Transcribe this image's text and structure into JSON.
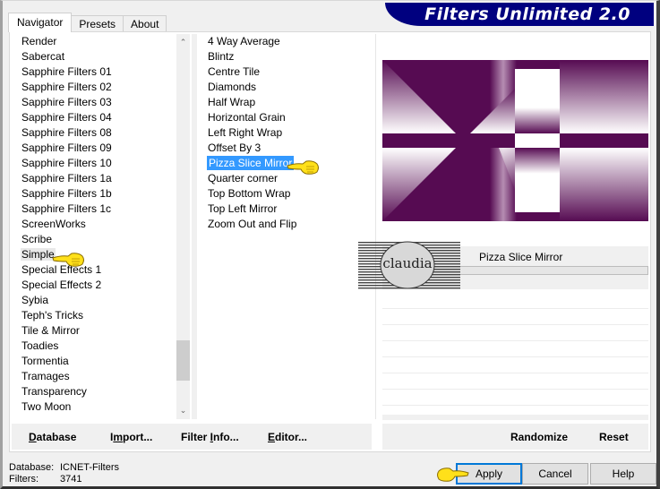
{
  "banner": {
    "title": "Filters Unlimited 2.0",
    "background": "#00007f"
  },
  "tabs": [
    {
      "label": "Navigator",
      "active": true
    },
    {
      "label": "Presets",
      "active": false
    },
    {
      "label": "About",
      "active": false
    }
  ],
  "categories": {
    "items": [
      "Render",
      "Sabercat",
      "Sapphire Filters 01",
      "Sapphire Filters 02",
      "Sapphire Filters 03",
      "Sapphire Filters 04",
      "Sapphire Filters 08",
      "Sapphire Filters 09",
      "Sapphire Filters 10",
      "Sapphire Filters 1a",
      "Sapphire Filters 1b",
      "Sapphire Filters 1c",
      "ScreenWorks",
      "Scribe",
      "Simple",
      "Special Effects 1",
      "Special Effects 2",
      "Sybia",
      "Teph's Tricks",
      "Tile & Mirror",
      "Toadies",
      "Tormentia",
      "Tramages",
      "Transparency",
      "Two Moon"
    ],
    "selected": "Simple",
    "scroll_up_icon": "^",
    "scroll_down_icon": "v"
  },
  "filters": {
    "items": [
      "4 Way Average",
      "Blintz",
      "Centre Tile",
      "Diamonds",
      "Half Wrap",
      "Horizontal Grain",
      "Left Right Wrap",
      "Offset By 3",
      "Pizza Slice Mirror",
      "Quarter corner",
      "Top Bottom Wrap",
      "Top Left Mirror",
      "Zoom Out and Flip"
    ],
    "selected": "Pizza Slice Mirror"
  },
  "preview": {
    "primary_color": "#560b52",
    "highlight_color": "#ffffff"
  },
  "info": {
    "filter_name": "Pizza Slice Mirror",
    "logo_text": "claudia"
  },
  "actions_left": {
    "database": "Database",
    "import": "Import...",
    "filter_info": "Filter Info...",
    "editor": "Editor..."
  },
  "actions_right": {
    "randomize": "Randomize",
    "reset": "Reset"
  },
  "footer": {
    "database_label": "Database:",
    "database_value": "ICNET-Filters",
    "filters_label": "Filters:",
    "filters_value": "3741"
  },
  "buttons": {
    "apply": "Apply",
    "cancel": "Cancel",
    "help": "Help"
  }
}
